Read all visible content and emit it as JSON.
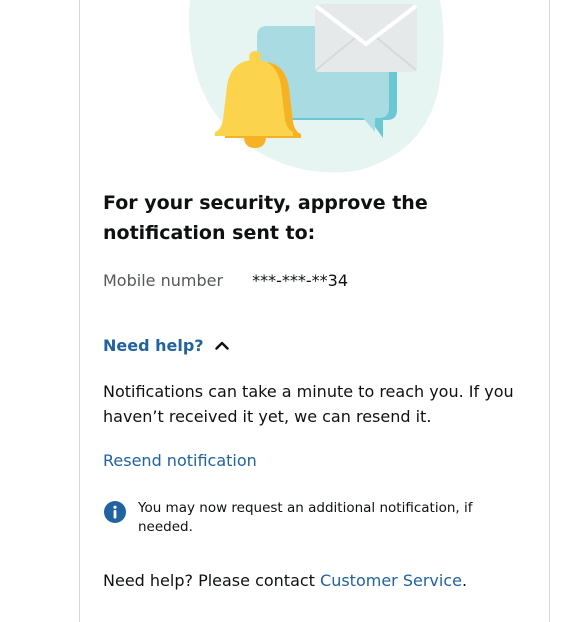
{
  "illustration": {
    "bell_icon": "bell-icon",
    "chat_icon": "chat-bubble-icon",
    "envelope_icon": "envelope-icon",
    "colors": {
      "blob": "#e6f4f2",
      "bubble": "#a9dbe2",
      "bubble_shadow": "#6cc7d4",
      "bell": "#fcd34d",
      "bell_shadow": "#f5b324",
      "envelope": "#e6e9ea"
    }
  },
  "main": {
    "heading": "For your security, approve the notification sent to:",
    "phone_label": "Mobile number",
    "phone_value": "***-***-**34",
    "need_help_label": "Need help?",
    "need_help_icon": "chevron-up-icon",
    "help_text": "Notifications can take a minute to reach you. If you haven’t received it yet, we can resend it.",
    "resend_label": "Resend notification",
    "info_icon": "info-icon",
    "info_text": "You may now request an additional notification, if needed.",
    "footer_prefix": "Need help? Please contact ",
    "footer_link": "Customer Service",
    "footer_suffix": "."
  },
  "colors": {
    "link": "#2162a1",
    "text": "#0f1111",
    "muted": "#565959",
    "info": "#2162a1"
  }
}
